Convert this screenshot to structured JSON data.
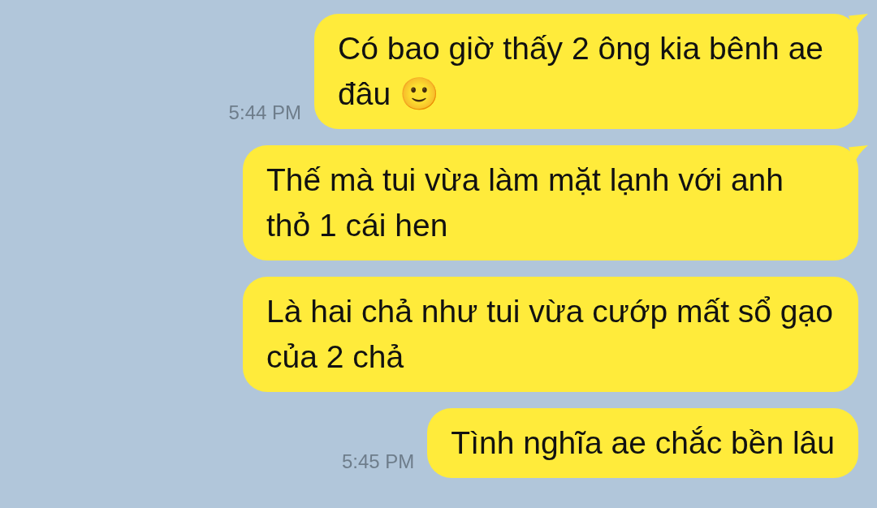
{
  "messages": [
    {
      "text": "Có bao giờ thấy 2 ông kia bênh ae đâu 🙂",
      "time": "5:44 PM",
      "tail": true
    },
    {
      "text": "Thế mà tui vừa làm mặt lạnh với anh thỏ 1 cái hen",
      "tail": true
    },
    {
      "text": "Là hai chả như tui vừa cướp mất sổ gạo của 2 chả",
      "tail": false
    },
    {
      "text": "Tình nghĩa ae chắc bền lâu",
      "time": "5:45 PM",
      "tail": false
    }
  ]
}
